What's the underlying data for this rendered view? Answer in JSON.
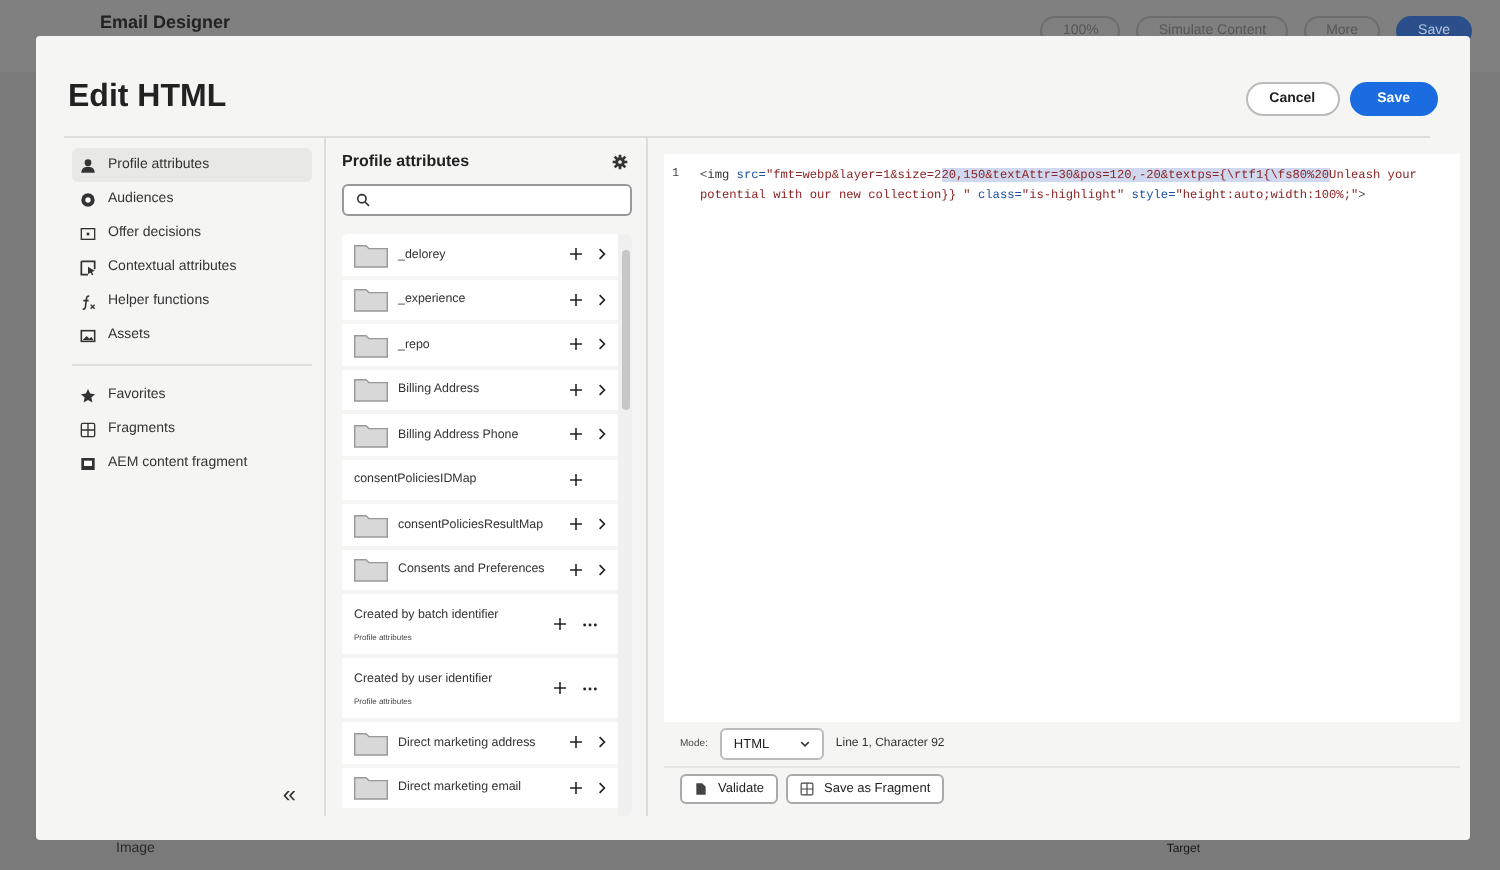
{
  "app": {
    "title": "Email Designer",
    "zoom": "100%",
    "simulate": "Simulate Content",
    "more": "More",
    "save": "Save",
    "bottom_item": "Image",
    "bottom_label": "Target"
  },
  "dialog": {
    "title": "Edit HTML",
    "cancel": "Cancel",
    "save": "Save"
  },
  "nav_groups": [
    [
      {
        "label": "Profile attributes",
        "selected": true
      },
      {
        "label": "Audiences",
        "selected": false
      },
      {
        "label": "Offer decisions",
        "selected": false
      },
      {
        "label": "Contextual attributes",
        "selected": false
      },
      {
        "label": "Helper functions",
        "selected": false
      },
      {
        "label": "Assets",
        "selected": false
      }
    ],
    [
      {
        "label": "Favorites",
        "selected": false
      },
      {
        "label": "Fragments",
        "selected": false
      },
      {
        "label": "AEM content fragment",
        "selected": false
      }
    ]
  ],
  "collapse": "«",
  "attributes": {
    "title": "Profile attributes",
    "items": [
      {
        "kind": "folder",
        "label": "_delorey"
      },
      {
        "kind": "folder",
        "label": "_experience"
      },
      {
        "kind": "folder",
        "label": "_repo"
      },
      {
        "kind": "folder",
        "label": "Billing Address"
      },
      {
        "kind": "folder",
        "label": "Billing Address Phone"
      },
      {
        "kind": "plain",
        "label": "consentPoliciesIDMap"
      },
      {
        "kind": "folder",
        "label": "consentPoliciesResultMap"
      },
      {
        "kind": "folder",
        "label": "Consents and Preferences"
      },
      {
        "kind": "field",
        "label": "Created by batch identifier",
        "subtitle": "Profile attributes"
      },
      {
        "kind": "field",
        "label": "Created by user identifier",
        "subtitle": "Profile attributes"
      },
      {
        "kind": "folder",
        "label": "Direct marketing address"
      },
      {
        "kind": "folder",
        "label": "Direct marketing email"
      }
    ]
  },
  "editor": {
    "line_number": "1",
    "segments": [
      {
        "kind": "tag",
        "text": "<img ",
        "selected": false
      },
      {
        "kind": "attr",
        "text": "src=",
        "selected": false
      },
      {
        "kind": "value",
        "text": "\"fmt=webp&layer=1&size=2",
        "selected": false
      },
      {
        "kind": "value",
        "text": "20,150&textAttr=30&pos=120,-20&textps={\\rtf1{\\fs80%20",
        "selected": true
      },
      {
        "kind": "value",
        "text": "Unleash your potential with our new collection}} \"",
        "selected": false
      },
      {
        "kind": "attr",
        "text": " class=",
        "selected": false
      },
      {
        "kind": "value",
        "text": "\"is-highlight\"",
        "selected": false
      },
      {
        "kind": "attr",
        "text": " style=",
        "selected": false
      },
      {
        "kind": "value",
        "text": "\"height:auto;width:100%;\"",
        "selected": false
      },
      {
        "kind": "tag",
        "text": ">",
        "selected": false
      }
    ],
    "mode_label": "Mode:",
    "mode": "HTML",
    "position": "Line 1, Character 92",
    "validate": "Validate",
    "save_fragment": "Save as Fragment"
  }
}
